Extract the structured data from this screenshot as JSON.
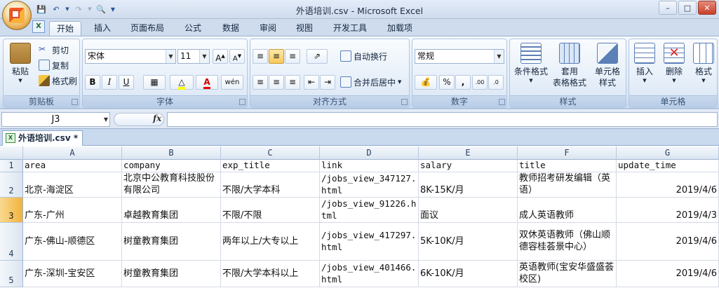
{
  "window": {
    "title": "外语培训.csv - Microsoft Excel"
  },
  "tabs": [
    "开始",
    "插入",
    "页面布局",
    "公式",
    "数据",
    "审阅",
    "视图",
    "开发工具",
    "加载项"
  ],
  "clipboard": {
    "paste": "粘贴",
    "cut": "剪切",
    "copy": "复制",
    "format_painter": "格式刷",
    "title": "剪贴板"
  },
  "font": {
    "name": "宋体",
    "size": "11",
    "bold": "B",
    "italic": "I",
    "underline": "U",
    "title": "字体"
  },
  "alignment": {
    "wrap": "自动换行",
    "merge": "合并后居中",
    "title": "对齐方式"
  },
  "number": {
    "format": "常规",
    "percent": "%",
    "comma": ",",
    "title": "数字"
  },
  "styles": {
    "conditional": "条件格式",
    "table_format_1": "套用",
    "table_format_2": "表格格式",
    "cell_styles_1": "单元格",
    "cell_styles_2": "样式",
    "title": "样式"
  },
  "cells": {
    "insert": "插入",
    "delete": "删除",
    "format": "格式",
    "title": "单元格"
  },
  "formula_bar": {
    "name_box": "J3",
    "fx": "fx",
    "value": ""
  },
  "sheet_tab": "外语培训.csv *",
  "columns": [
    "A",
    "B",
    "C",
    "D",
    "E",
    "F",
    "G"
  ],
  "rows": [
    {
      "num": "1",
      "cells": [
        "area",
        "company",
        "exp_title",
        "link",
        "salary",
        "title",
        "update_time"
      ]
    },
    {
      "num": "2",
      "cells": [
        "北京-海淀区",
        "北京中公教育科技股份有限公司",
        "不限/大学本科",
        "/jobs_view_347127.html",
        "8K-15K/月",
        "教师招考研发编辑（英语）",
        "2019/4/6"
      ]
    },
    {
      "num": "3",
      "cells": [
        "广东-广州",
        "卓越教育集团",
        "不限/不限",
        "/jobs_view_91226.html",
        "面议",
        "成人英语教师",
        "2019/4/3"
      ]
    },
    {
      "num": "4",
      "cells": [
        "广东-佛山-顺德区",
        "树童教育集团",
        "两年以上/大专以上",
        "/jobs_view_417297.html",
        "5K-10K/月",
        "双休英语教师（佛山顺德容桂荟景中心）",
        "2019/4/6"
      ]
    },
    {
      "num": "5",
      "cells": [
        "广东-深圳-宝安区",
        "树童教育集团",
        "不限/大学本科以上",
        "/jobs_view_401466.html",
        "6K-10K/月",
        "英语教师(宝安华盛盛荟校区)",
        "2019/4/6"
      ]
    }
  ],
  "selected_row": "3"
}
